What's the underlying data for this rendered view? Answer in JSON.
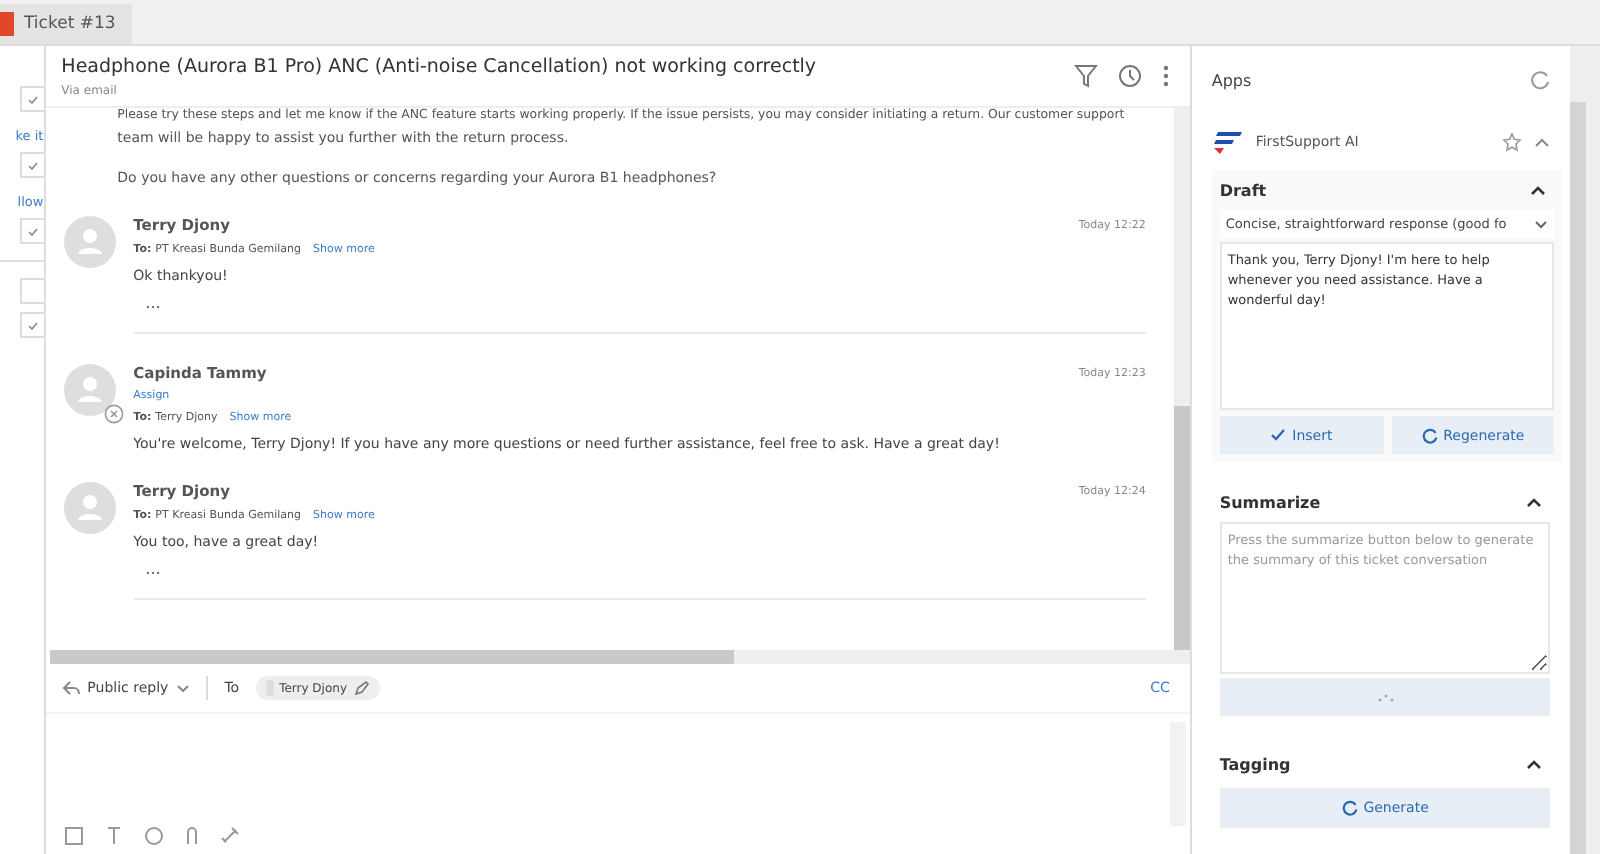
{
  "tab": {
    "label": "Ticket #13"
  },
  "sidebar": {
    "items": [
      {
        "kind": "checkbox",
        "checked": true
      },
      {
        "kind": "label",
        "label": "ke it"
      },
      {
        "kind": "checkbox",
        "checked": true
      },
      {
        "kind": "label",
        "label": "llow"
      },
      {
        "kind": "checkbox",
        "checked": true
      },
      {
        "kind": "divider"
      },
      {
        "kind": "checkbox",
        "checked": false
      },
      {
        "kind": "checkbox",
        "checked": true
      }
    ]
  },
  "ticket": {
    "title": "Headphone (Aurora B1 Pro) ANC (Anti-noise Cancellation) not working correctly",
    "channel": "Via email"
  },
  "previous_message": {
    "lines": [
      "Please try these steps and let me know if the ANC feature starts working properly. If the issue persists, you may consider initiating a return. Our customer support",
      "team will be happy to assist you further with the return process.",
      "Do you have any other questions or concerns regarding your Aurora B1 headphones?"
    ]
  },
  "messages": [
    {
      "kind": "customer",
      "name": "Terry Djony",
      "time": "Today 12:22",
      "to_label": "To:",
      "to": "PT Kreasi Bunda Gemilang",
      "show_more": "Show more",
      "body": "Ok thankyou!",
      "ellipsis": "..."
    },
    {
      "kind": "agent",
      "name": "Capinda Tammy",
      "assign": "Assign",
      "time": "Today 12:23",
      "to_label": "To:",
      "to": "Terry Djony",
      "show_more": "Show more",
      "body": "You're welcome, Terry Djony! If you have any more questions or need further assistance, feel free to ask. Have a great day!"
    },
    {
      "kind": "customer",
      "name": "Terry Djony",
      "time": "Today 12:24",
      "to_label": "To:",
      "to": "PT Kreasi Bunda Gemilang",
      "show_more": "Show more",
      "body": "You too, have a great day!",
      "ellipsis": "..."
    }
  ],
  "reply": {
    "mode": "Public reply",
    "to_label": "To",
    "recipient": "Terry Djony",
    "cc": "CC"
  },
  "apps": {
    "title": "Apps",
    "app_name": "FirstSupport AI",
    "draft": {
      "title": "Draft",
      "tone": "Concise, straightforward response (good fo",
      "text": "Thank you, Terry Djony! I'm here to help whenever you need assistance. Have a wonderful day!",
      "insert": "Insert",
      "regenerate": "Regenerate"
    },
    "summarize": {
      "title": "Summarize",
      "placeholder": "Press the summarize button below to generate the summary of this ticket conversation",
      "loading": true
    },
    "tagging": {
      "title": "Tagging",
      "generate": "Generate"
    }
  }
}
